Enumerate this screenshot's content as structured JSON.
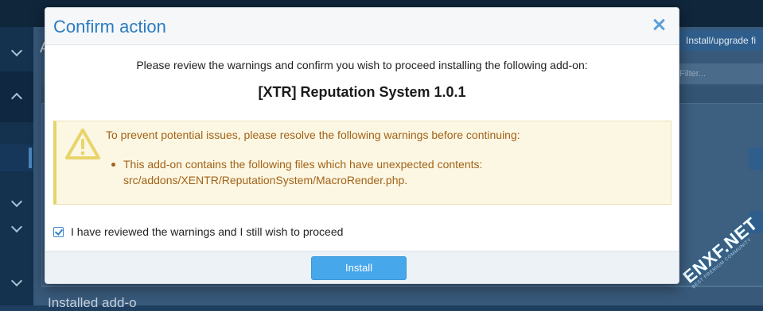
{
  "background": {
    "content_title": "A",
    "upgrade_button_label": "Install/upgrade fi",
    "filter_placeholder": "Filter...",
    "section_heading": "Installed add-o"
  },
  "watermark": {
    "text": "ENXF.NET",
    "subtext": "BEST PREMIUM COMMUNITY"
  },
  "modal": {
    "title": "Confirm action",
    "close_icon": "close-icon",
    "intro": "Please review the warnings and confirm you wish to proceed installing the following add-on:",
    "addon_name": "[XTR] Reputation System 1.0.1",
    "warning": {
      "icon": "warning-triangle-icon",
      "lead": "To prevent potential issues, please resolve the following warnings before continuing:",
      "items": [
        {
          "line1": "This add-on contains the following files which have unexpected contents:",
          "line2": "src/addons/XENTR/ReputationSystem/MacroRender.php."
        }
      ]
    },
    "confirm": {
      "checked": true,
      "label": "I have reviewed the warnings and I still wish to proceed"
    },
    "install_label": "Install"
  },
  "colors": {
    "accent": "#2b7cc1",
    "install_button": "#47a7eb",
    "warning_text": "#a36217",
    "warning_bg": "#fbf7e3",
    "overlay_bg": "#1f3f60"
  }
}
